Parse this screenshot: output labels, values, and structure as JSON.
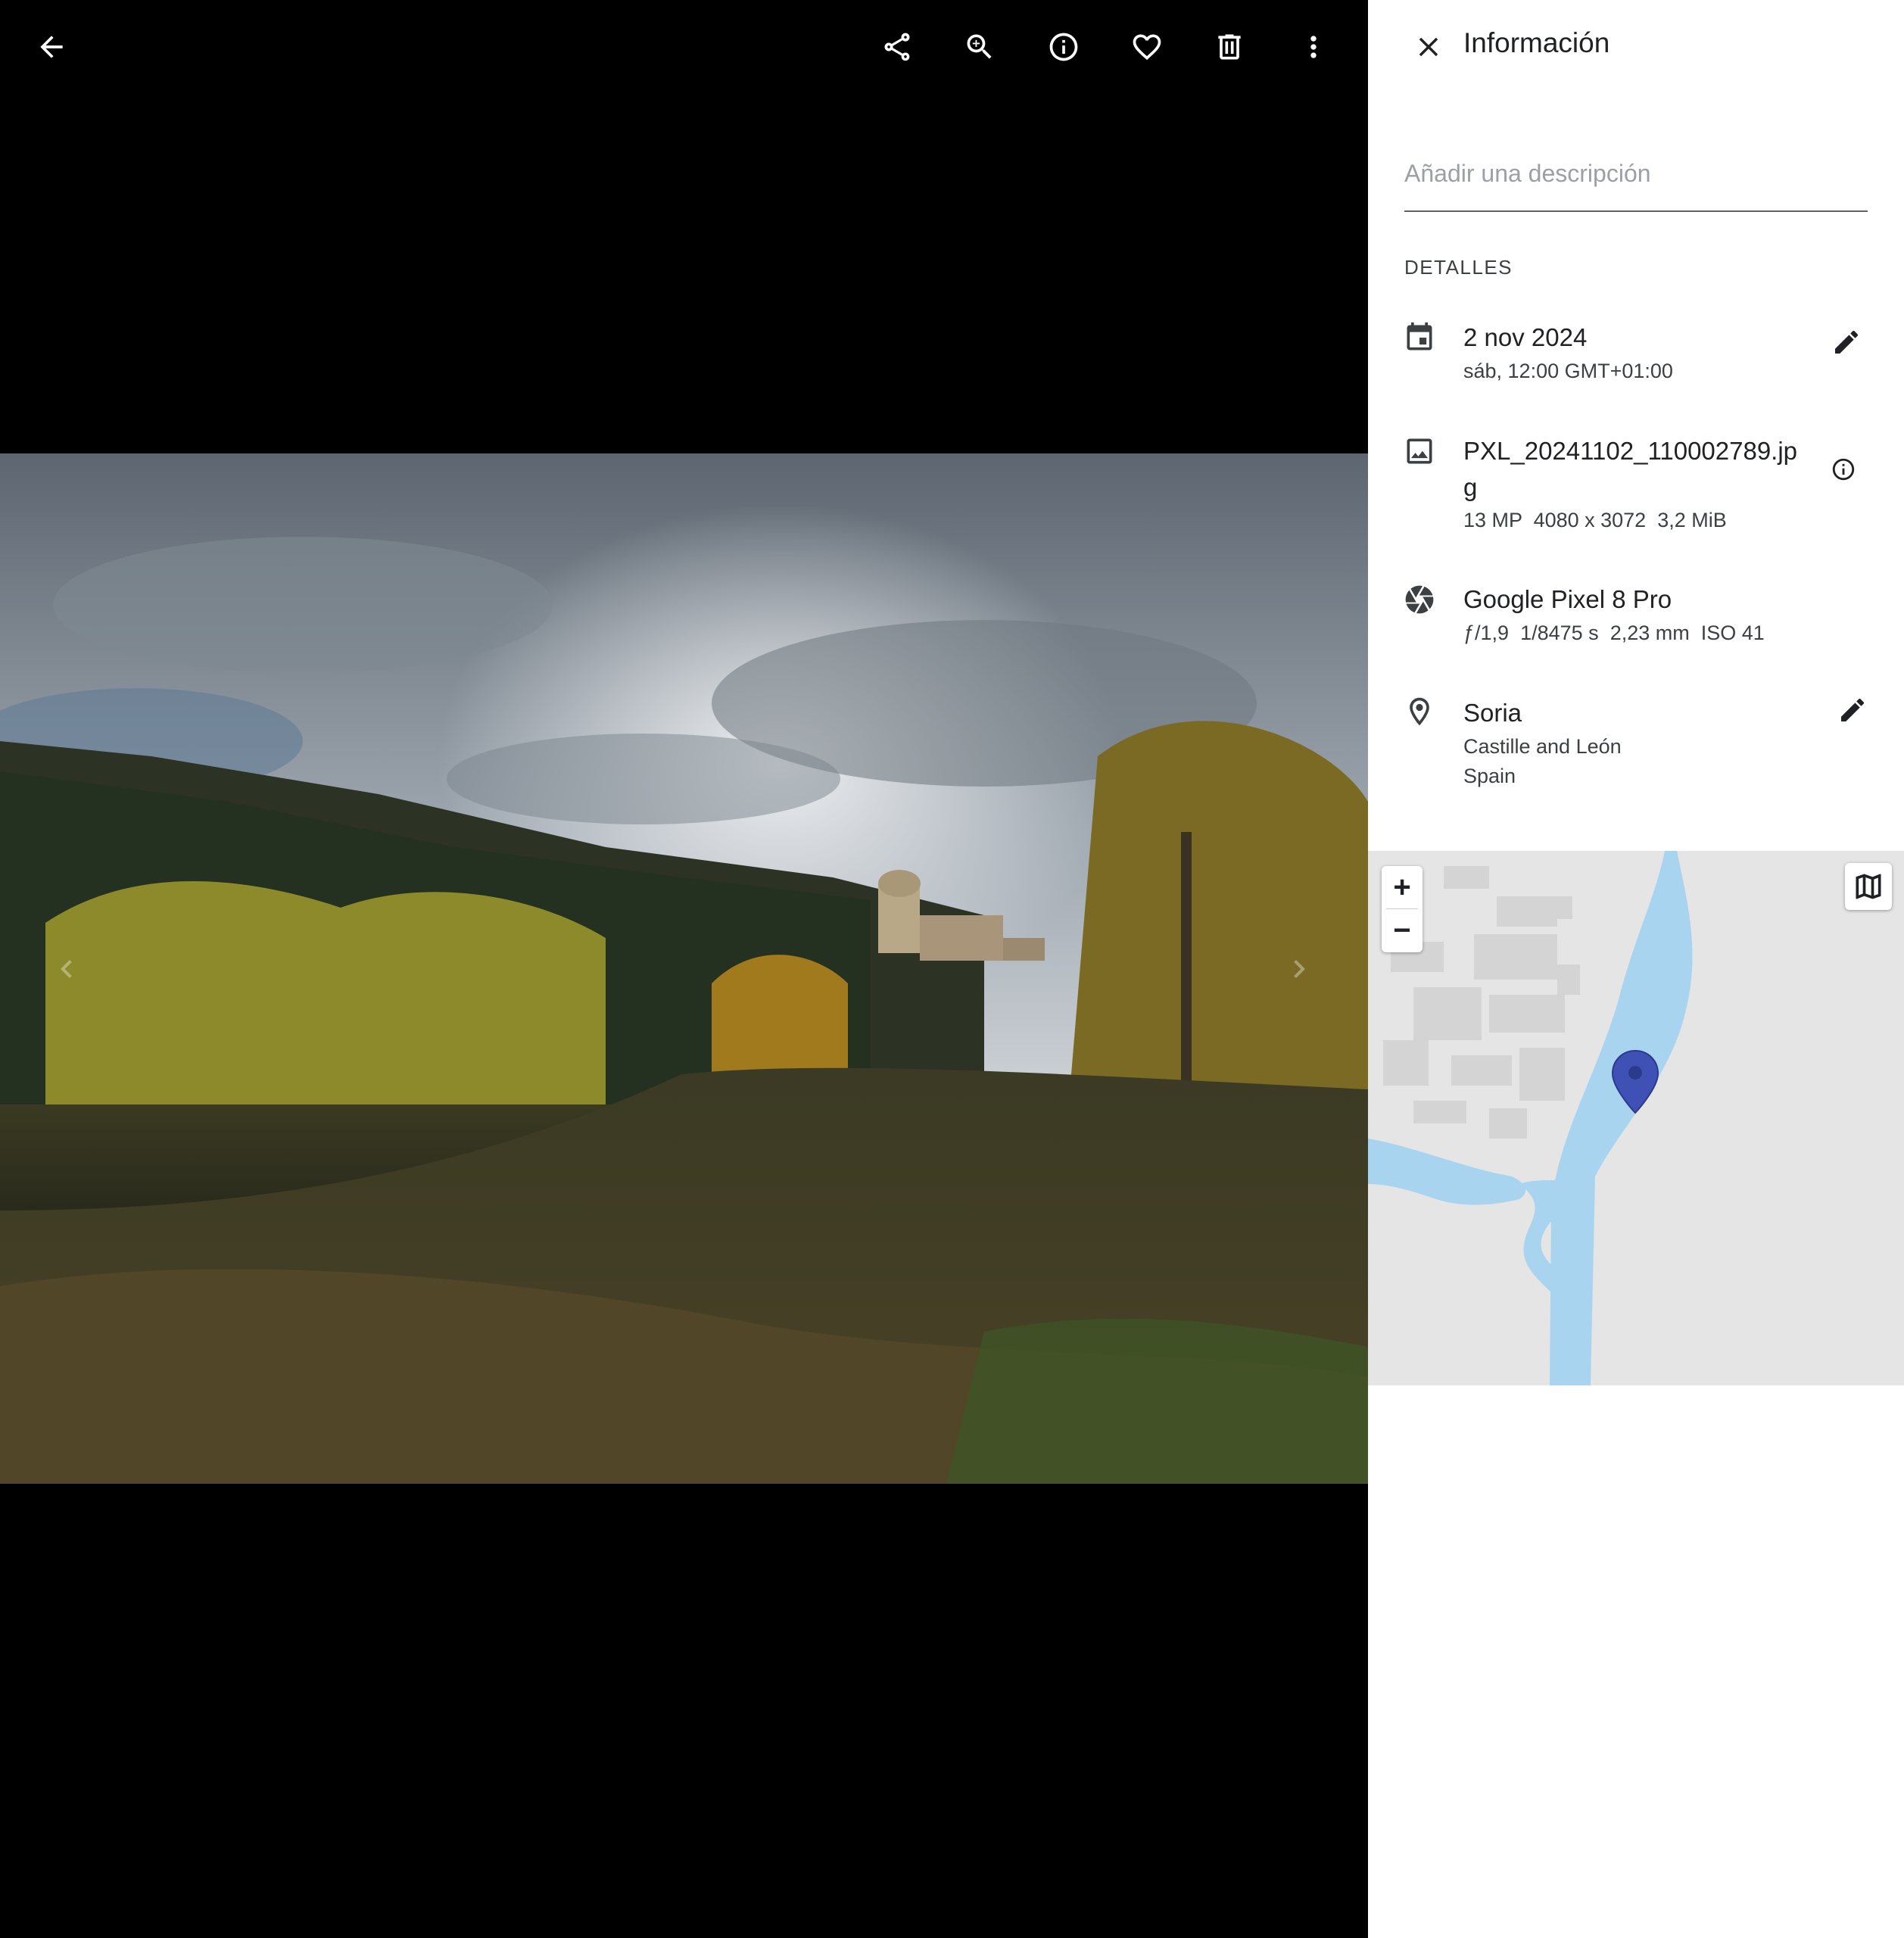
{
  "panel": {
    "title": "Información",
    "description_placeholder": "Añadir una descripción",
    "details_header": "DETALLES"
  },
  "date": {
    "primary": "2 nov 2024",
    "secondary": "sáb, 12:00 GMT+01:00"
  },
  "file": {
    "name_line1": "PXL_20241102_110002789.jp",
    "name_line2": "g",
    "megapixels": "13 MP",
    "dimensions": "4080 x 3072",
    "size": "3,2 MiB"
  },
  "camera": {
    "model": "Google Pixel 8 Pro",
    "aperture": "ƒ/1,9",
    "shutter": "1/8475 s",
    "focal_length": "2,23 mm",
    "iso": "ISO 41"
  },
  "location": {
    "city": "Soria",
    "region": "Castille and León",
    "country": "Spain"
  },
  "map": {
    "zoom_in": "+",
    "zoom_out": "−"
  },
  "icons": {
    "toolbar": [
      "back-arrow-icon",
      "share-icon",
      "zoom-in-icon",
      "info-icon",
      "heart-icon",
      "trash-icon",
      "more-vert-icon"
    ],
    "details": [
      "calendar-icon",
      "image-icon",
      "camera-aperture-icon",
      "location-pin-icon"
    ]
  },
  "colors": {
    "viewer_bg": "#000000",
    "panel_bg": "#ffffff",
    "map_water": "#a8d4f0",
    "map_pin": "#3f51b5"
  }
}
